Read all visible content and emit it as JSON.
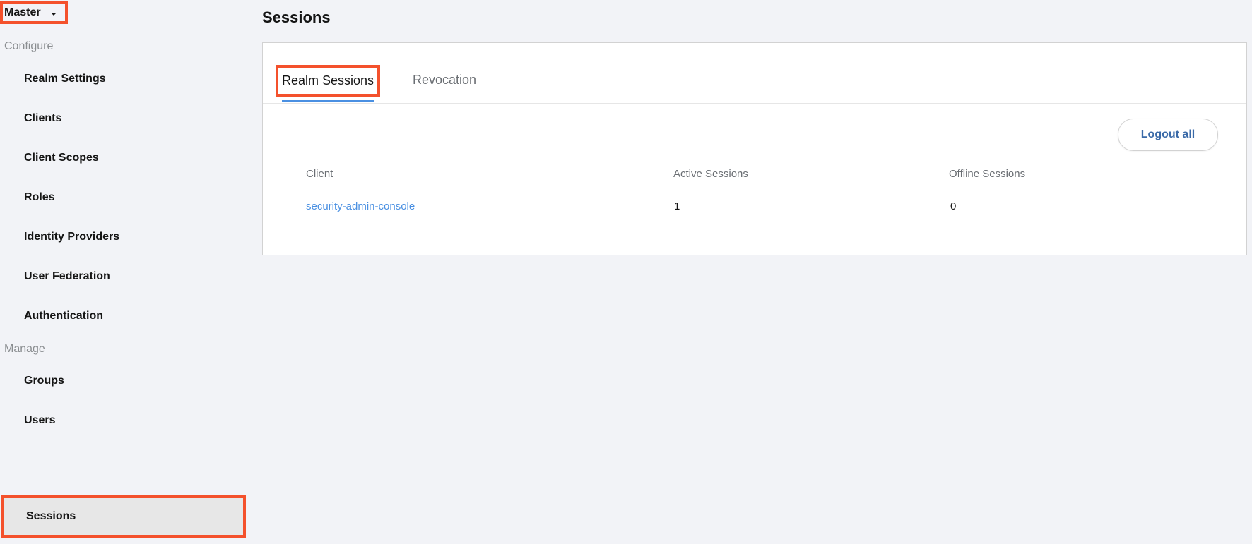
{
  "realm": {
    "name": "Master"
  },
  "sidebar": {
    "configure_label": "Configure",
    "configure_items": [
      {
        "label": "Realm Settings"
      },
      {
        "label": "Clients"
      },
      {
        "label": "Client Scopes"
      },
      {
        "label": "Roles"
      },
      {
        "label": "Identity Providers"
      },
      {
        "label": "User Federation"
      },
      {
        "label": "Authentication"
      }
    ],
    "manage_label": "Manage",
    "manage_items": [
      {
        "label": "Groups"
      },
      {
        "label": "Users"
      },
      {
        "label": "Sessions"
      }
    ],
    "active_item": "Sessions"
  },
  "main": {
    "title": "Sessions",
    "tabs": [
      {
        "label": "Realm Sessions",
        "active": true
      },
      {
        "label": "Revocation",
        "active": false
      }
    ],
    "logout_all_label": "Logout all",
    "table": {
      "headers": [
        "Client",
        "Active Sessions",
        "Offline Sessions"
      ],
      "rows": [
        {
          "client": "security-admin-console",
          "active_sessions": "1",
          "offline_sessions": "0"
        }
      ]
    }
  },
  "colors": {
    "highlight": "#f4512c",
    "link": "#4a90e2",
    "button_text": "#3a6aa8",
    "background": "#f2f3f7"
  }
}
